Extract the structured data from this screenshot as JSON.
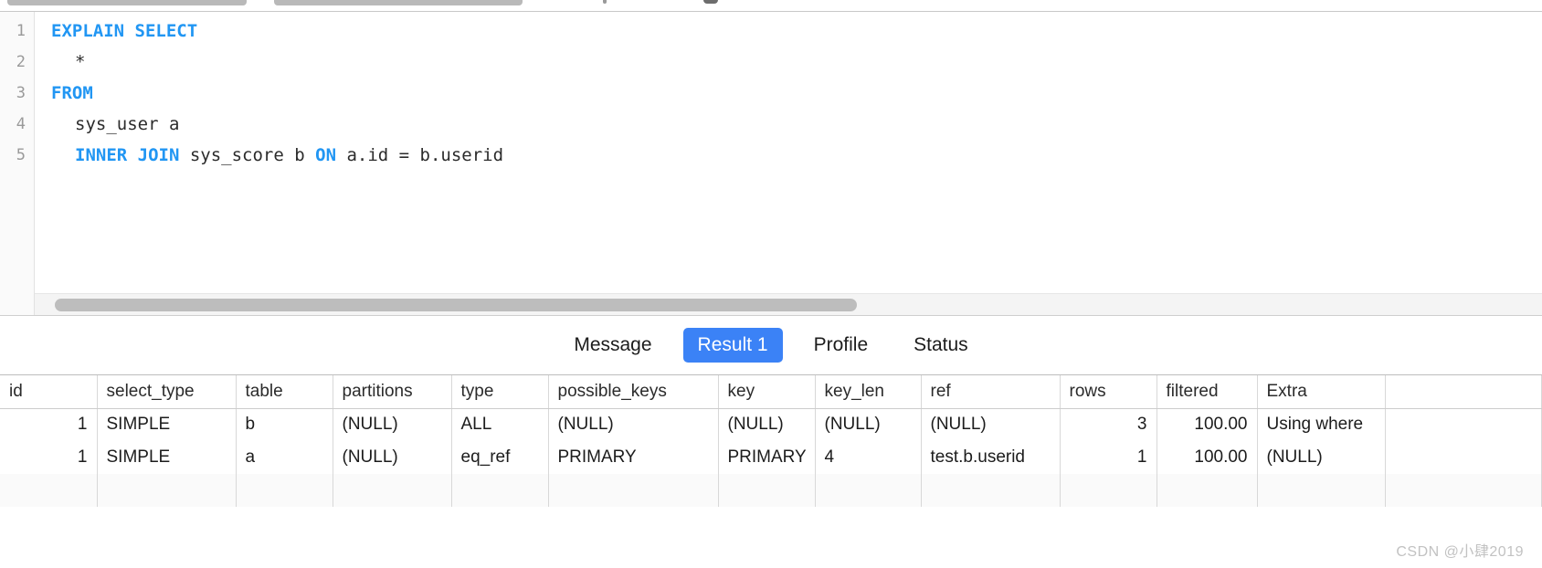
{
  "toolbar": {
    "note": "cut-off toolbar controls at top edge"
  },
  "editor": {
    "line_numbers": [
      "1",
      "2",
      "3",
      "4",
      "5"
    ],
    "lines": [
      {
        "indent": 0,
        "tokens": [
          {
            "t": "EXPLAIN SELECT",
            "k": true
          }
        ]
      },
      {
        "indent": 1,
        "tokens": [
          {
            "t": "*",
            "k": false
          }
        ]
      },
      {
        "indent": 0,
        "tokens": [
          {
            "t": "FROM",
            "k": true
          }
        ]
      },
      {
        "indent": 1,
        "tokens": [
          {
            "t": "sys_user a",
            "k": false
          }
        ]
      },
      {
        "indent": 1,
        "tokens": [
          {
            "t": "INNER JOIN ",
            "k": true
          },
          {
            "t": "sys_score b ",
            "k": false
          },
          {
            "t": "ON ",
            "k": true
          },
          {
            "t": "a.id = b.userid",
            "k": false
          }
        ]
      }
    ],
    "sql_text": "EXPLAIN SELECT\n  *\nFROM\n  sys_user a\n  INNER JOIN sys_score b ON a.id = b.userid"
  },
  "tabs": {
    "items": [
      {
        "label": "Message",
        "active": false
      },
      {
        "label": "Result 1",
        "active": true
      },
      {
        "label": "Profile",
        "active": false
      },
      {
        "label": "Status",
        "active": false
      }
    ],
    "active_color": "#3b82f6"
  },
  "result_grid": {
    "columns": [
      "id",
      "select_type",
      "table",
      "partitions",
      "type",
      "possible_keys",
      "key",
      "key_len",
      "ref",
      "rows",
      "filtered",
      "Extra"
    ],
    "rows": [
      {
        "id": "1",
        "select_type": "SIMPLE",
        "table": "b",
        "partitions": "(NULL)",
        "type": "ALL",
        "possible_keys": "(NULL)",
        "key": "(NULL)",
        "key_len": "(NULL)",
        "ref": "(NULL)",
        "rows": "3",
        "filtered": "100.00",
        "Extra": "Using where"
      },
      {
        "id": "1",
        "select_type": "SIMPLE",
        "table": "a",
        "partitions": "(NULL)",
        "type": "eq_ref",
        "possible_keys": "PRIMARY",
        "key": "PRIMARY",
        "key_len": "4",
        "ref": "test.b.userid",
        "rows": "1",
        "filtered": "100.00",
        "Extra": "(NULL)"
      }
    ],
    "null_token": "(NULL)"
  },
  "watermark": {
    "text": "CSDN @小肆2019"
  }
}
